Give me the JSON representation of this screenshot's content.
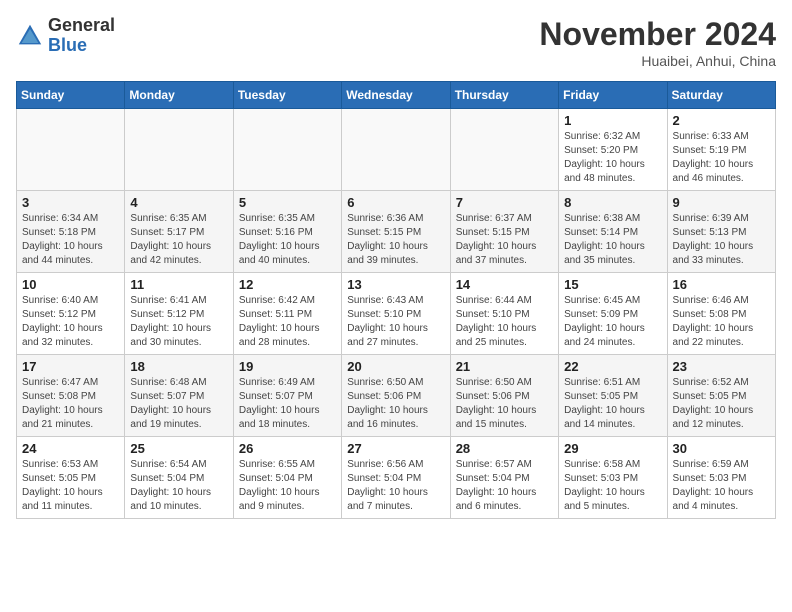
{
  "header": {
    "logo_general": "General",
    "logo_blue": "Blue",
    "month_title": "November 2024",
    "location": "Huaibei, Anhui, China"
  },
  "days_of_week": [
    "Sunday",
    "Monday",
    "Tuesday",
    "Wednesday",
    "Thursday",
    "Friday",
    "Saturday"
  ],
  "weeks": [
    [
      {
        "day": "",
        "info": ""
      },
      {
        "day": "",
        "info": ""
      },
      {
        "day": "",
        "info": ""
      },
      {
        "day": "",
        "info": ""
      },
      {
        "day": "",
        "info": ""
      },
      {
        "day": "1",
        "info": "Sunrise: 6:32 AM\nSunset: 5:20 PM\nDaylight: 10 hours and 48 minutes."
      },
      {
        "day": "2",
        "info": "Sunrise: 6:33 AM\nSunset: 5:19 PM\nDaylight: 10 hours and 46 minutes."
      }
    ],
    [
      {
        "day": "3",
        "info": "Sunrise: 6:34 AM\nSunset: 5:18 PM\nDaylight: 10 hours and 44 minutes."
      },
      {
        "day": "4",
        "info": "Sunrise: 6:35 AM\nSunset: 5:17 PM\nDaylight: 10 hours and 42 minutes."
      },
      {
        "day": "5",
        "info": "Sunrise: 6:35 AM\nSunset: 5:16 PM\nDaylight: 10 hours and 40 minutes."
      },
      {
        "day": "6",
        "info": "Sunrise: 6:36 AM\nSunset: 5:15 PM\nDaylight: 10 hours and 39 minutes."
      },
      {
        "day": "7",
        "info": "Sunrise: 6:37 AM\nSunset: 5:15 PM\nDaylight: 10 hours and 37 minutes."
      },
      {
        "day": "8",
        "info": "Sunrise: 6:38 AM\nSunset: 5:14 PM\nDaylight: 10 hours and 35 minutes."
      },
      {
        "day": "9",
        "info": "Sunrise: 6:39 AM\nSunset: 5:13 PM\nDaylight: 10 hours and 33 minutes."
      }
    ],
    [
      {
        "day": "10",
        "info": "Sunrise: 6:40 AM\nSunset: 5:12 PM\nDaylight: 10 hours and 32 minutes."
      },
      {
        "day": "11",
        "info": "Sunrise: 6:41 AM\nSunset: 5:12 PM\nDaylight: 10 hours and 30 minutes."
      },
      {
        "day": "12",
        "info": "Sunrise: 6:42 AM\nSunset: 5:11 PM\nDaylight: 10 hours and 28 minutes."
      },
      {
        "day": "13",
        "info": "Sunrise: 6:43 AM\nSunset: 5:10 PM\nDaylight: 10 hours and 27 minutes."
      },
      {
        "day": "14",
        "info": "Sunrise: 6:44 AM\nSunset: 5:10 PM\nDaylight: 10 hours and 25 minutes."
      },
      {
        "day": "15",
        "info": "Sunrise: 6:45 AM\nSunset: 5:09 PM\nDaylight: 10 hours and 24 minutes."
      },
      {
        "day": "16",
        "info": "Sunrise: 6:46 AM\nSunset: 5:08 PM\nDaylight: 10 hours and 22 minutes."
      }
    ],
    [
      {
        "day": "17",
        "info": "Sunrise: 6:47 AM\nSunset: 5:08 PM\nDaylight: 10 hours and 21 minutes."
      },
      {
        "day": "18",
        "info": "Sunrise: 6:48 AM\nSunset: 5:07 PM\nDaylight: 10 hours and 19 minutes."
      },
      {
        "day": "19",
        "info": "Sunrise: 6:49 AM\nSunset: 5:07 PM\nDaylight: 10 hours and 18 minutes."
      },
      {
        "day": "20",
        "info": "Sunrise: 6:50 AM\nSunset: 5:06 PM\nDaylight: 10 hours and 16 minutes."
      },
      {
        "day": "21",
        "info": "Sunrise: 6:50 AM\nSunset: 5:06 PM\nDaylight: 10 hours and 15 minutes."
      },
      {
        "day": "22",
        "info": "Sunrise: 6:51 AM\nSunset: 5:05 PM\nDaylight: 10 hours and 14 minutes."
      },
      {
        "day": "23",
        "info": "Sunrise: 6:52 AM\nSunset: 5:05 PM\nDaylight: 10 hours and 12 minutes."
      }
    ],
    [
      {
        "day": "24",
        "info": "Sunrise: 6:53 AM\nSunset: 5:05 PM\nDaylight: 10 hours and 11 minutes."
      },
      {
        "day": "25",
        "info": "Sunrise: 6:54 AM\nSunset: 5:04 PM\nDaylight: 10 hours and 10 minutes."
      },
      {
        "day": "26",
        "info": "Sunrise: 6:55 AM\nSunset: 5:04 PM\nDaylight: 10 hours and 9 minutes."
      },
      {
        "day": "27",
        "info": "Sunrise: 6:56 AM\nSunset: 5:04 PM\nDaylight: 10 hours and 7 minutes."
      },
      {
        "day": "28",
        "info": "Sunrise: 6:57 AM\nSunset: 5:04 PM\nDaylight: 10 hours and 6 minutes."
      },
      {
        "day": "29",
        "info": "Sunrise: 6:58 AM\nSunset: 5:03 PM\nDaylight: 10 hours and 5 minutes."
      },
      {
        "day": "30",
        "info": "Sunrise: 6:59 AM\nSunset: 5:03 PM\nDaylight: 10 hours and 4 minutes."
      }
    ]
  ]
}
